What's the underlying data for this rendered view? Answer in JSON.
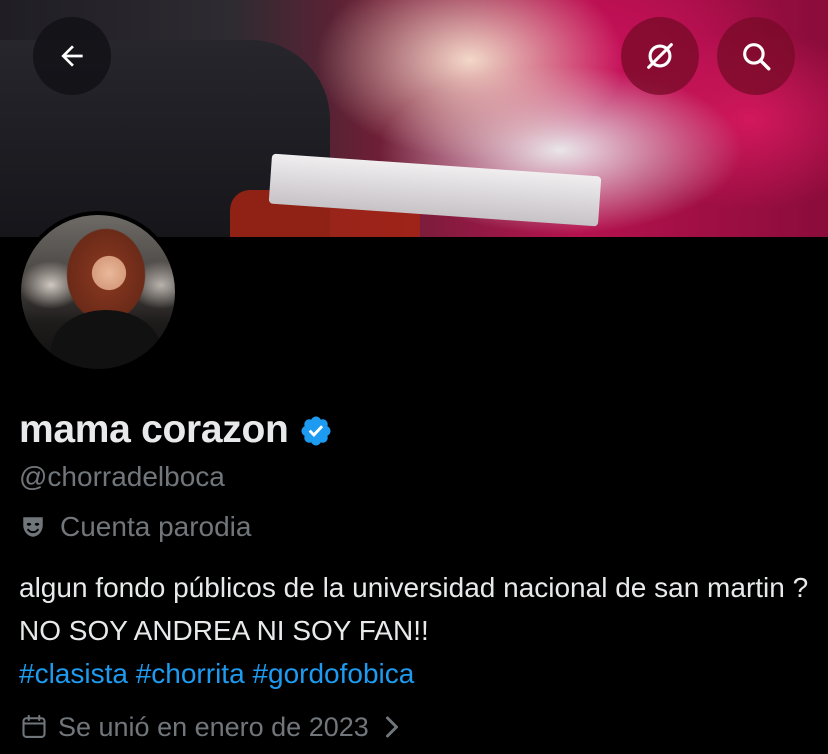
{
  "profile": {
    "display_name": "mama corazon",
    "handle": "@chorradelboca",
    "label": "Cuenta parodia",
    "bio_text": "algun fondo públicos de la universidad nacional de san martin ? NO SOY ANDREA NI SOY FAN!!",
    "hashtags": [
      "#clasista",
      "#chorrita",
      "#gordofobica"
    ],
    "joined": "Se unió en enero de 2023"
  },
  "icons": {
    "back": "back-arrow-icon",
    "no_link": "link-off-icon",
    "search": "search-icon",
    "verified": "verified-badge-icon",
    "parody": "parody-mask-icon",
    "calendar": "calendar-icon",
    "chevron": "chevron-right-icon"
  },
  "colors": {
    "background": "#000000",
    "text_primary": "#e7e9ea",
    "text_secondary": "#71767b",
    "accent": "#1d9bf0"
  }
}
